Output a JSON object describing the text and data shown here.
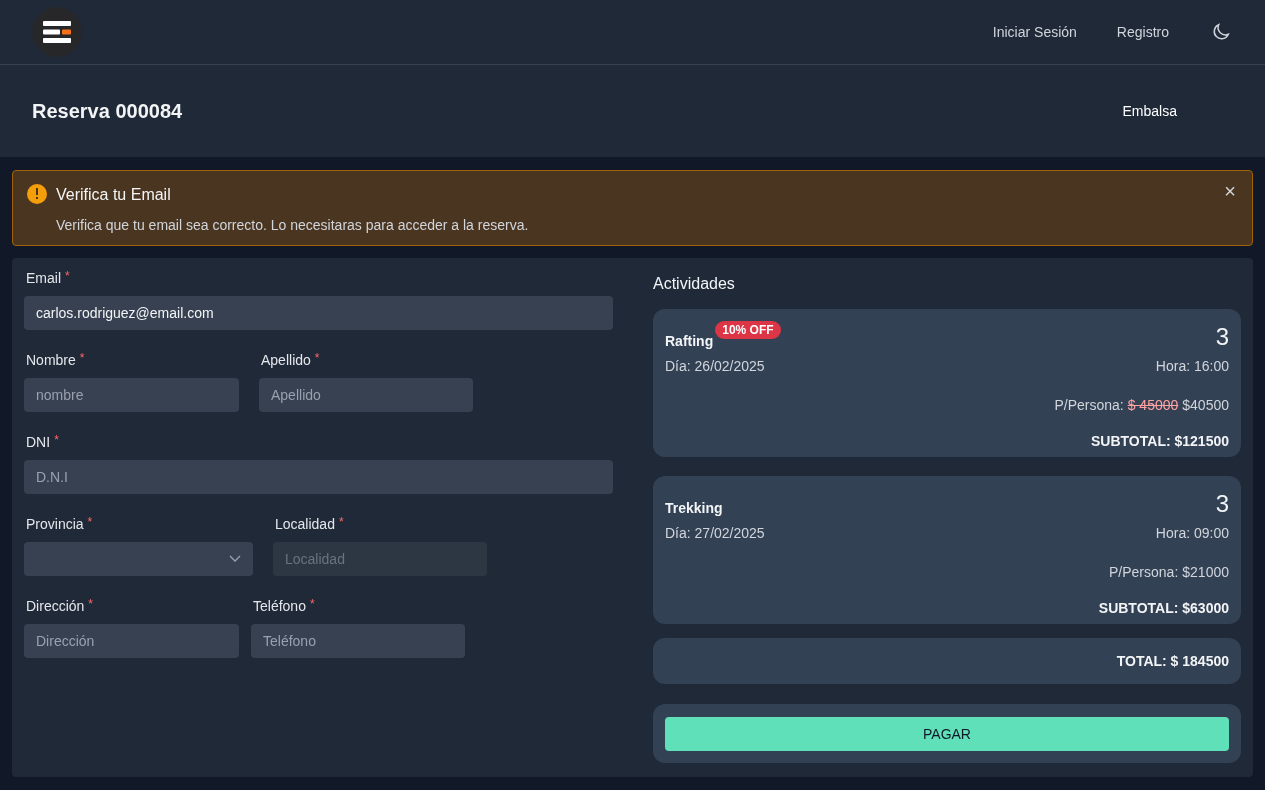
{
  "nav": {
    "links": [
      "Iniciar Sesión",
      "Registro"
    ]
  },
  "header": {
    "title": "Reserva 000084",
    "location": "Embalsa"
  },
  "alert": {
    "title": "Verifica tu Email",
    "message": "Verifica que tu email sea correcto. Lo necesitaras para acceder a la reserva.",
    "close": "×"
  },
  "form": {
    "rows": [
      [
        {
          "label": "Email",
          "required": "*",
          "kind": "text",
          "value": "carlos.rodriguez@email.com",
          "disabled": false
        }
      ],
      [
        {
          "label": "Nombre",
          "required": "*",
          "kind": "text",
          "placeholder": "nombre",
          "disabled": false
        },
        {
          "label": "Apellido",
          "required": "*",
          "kind": "text",
          "placeholder": "Apellido",
          "disabled": false
        }
      ],
      [
        {
          "label": "DNI",
          "required": "*",
          "kind": "text",
          "placeholder": "D.N.I",
          "disabled": false
        }
      ],
      [
        {
          "label": "Provincia",
          "required": "*",
          "kind": "select",
          "disabled": false
        },
        {
          "label": "Localidad",
          "required": "*",
          "kind": "text",
          "placeholder": "Localidad",
          "disabled": true
        }
      ],
      [
        {
          "label": "Dirección",
          "required": "*",
          "kind": "text",
          "placeholder": "Dirección",
          "disabled": false
        },
        {
          "label": "Teléfono",
          "required": "*",
          "kind": "text",
          "placeholder": "Teléfono",
          "disabled": false
        }
      ]
    ]
  },
  "activities": {
    "title": "Actividades",
    "items": [
      {
        "name": "Rafting",
        "badge": "10% OFF",
        "quantity": "3",
        "date": "Día: 26/02/2025",
        "time": "Hora: 16:00",
        "price_label": "P/Persona:",
        "original_price": "$ 45000",
        "price": "$40500",
        "subtotal": "SUBTOTAL: $121500"
      },
      {
        "name": "Trekking",
        "quantity": "3",
        "date": "Día: 27/02/2025",
        "time": "Hora: 09:00",
        "price_label": "P/Persona:",
        "price": "$21000",
        "subtotal": "SUBTOTAL: $63000"
      }
    ],
    "total": "TOTAL: $ 184500",
    "pay_button": "PAGAR"
  }
}
